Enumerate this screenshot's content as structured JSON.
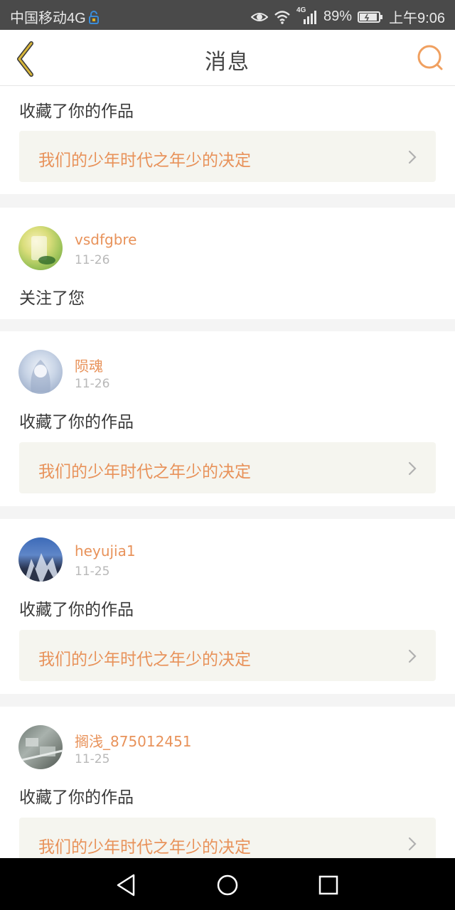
{
  "status_bar": {
    "carrier": "中国移动4G",
    "network": "4G",
    "battery": "89%",
    "time": "上午9:06",
    "icons": [
      "lock-icon",
      "eye-icon",
      "wifi-icon",
      "signal-icon",
      "battery-icon"
    ]
  },
  "header": {
    "title": "消息",
    "back_icon": "chevron-left-icon",
    "search_icon": "search-icon"
  },
  "colors": {
    "accent": "#e8925a",
    "back_arrow": "#c9a227"
  },
  "messages": [
    {
      "action": "收藏了你的作品",
      "work": "我们的少年时代之年少的决定"
    },
    {
      "user": "vsdfgbre",
      "date": "11-26",
      "action": "关注了您"
    },
    {
      "user": "陨魂",
      "date": "11-26",
      "action": "收藏了你的作品",
      "work": "我们的少年时代之年少的决定"
    },
    {
      "user": "heyujia1",
      "date": "11-25",
      "action": "收藏了你的作品",
      "work": "我们的少年时代之年少的决定"
    },
    {
      "user": "搁浅_875012451",
      "date": "11-25",
      "action": "收藏了你的作品",
      "work": "我们的少年时代之年少的决定"
    }
  ],
  "nav": {
    "icons": [
      "back-triangle-icon",
      "home-circle-icon",
      "recents-square-icon"
    ]
  }
}
